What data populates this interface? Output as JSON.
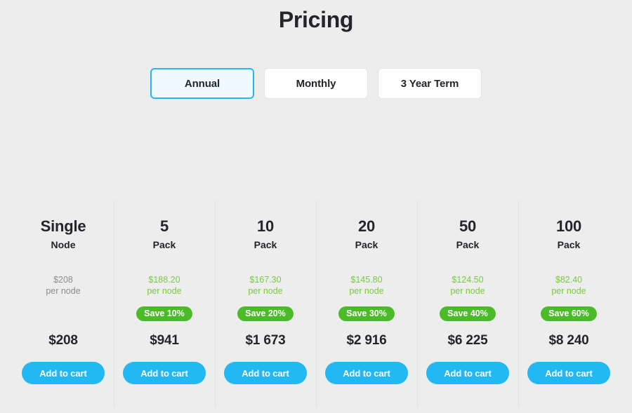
{
  "header": {
    "title": "Pricing"
  },
  "term_tabs": {
    "selected": "Annual",
    "items": [
      {
        "label": "Annual",
        "active": true
      },
      {
        "label": "Monthly",
        "active": false
      },
      {
        "label": "3 Year Term",
        "active": false
      }
    ]
  },
  "colors": {
    "page_background": "#ededed",
    "accent_blue": "#22b8f4",
    "tab_active_background": "#eff9ff",
    "tab_active_border": "#29b6f6",
    "badge_green": "#4cbb2a",
    "discount_text_green": "#7ac943",
    "muted_text": "#8c8c93",
    "divider": "#e1e1e1"
  },
  "plans": [
    {
      "quantity": "Single",
      "unit": "Node",
      "per_node_amount": "$208",
      "per_node_label": "per node",
      "discounted": false,
      "save_badge": null,
      "total": "$208",
      "cta_label": "Add to cart"
    },
    {
      "quantity": "5",
      "unit": "Pack",
      "per_node_amount": "$188.20",
      "per_node_label": "per node",
      "discounted": true,
      "save_badge": "Save 10%",
      "total": "$941",
      "cta_label": "Add to cart"
    },
    {
      "quantity": "10",
      "unit": "Pack",
      "per_node_amount": "$167.30",
      "per_node_label": "per node",
      "discounted": true,
      "save_badge": "Save 20%",
      "total": "$1 673",
      "cta_label": "Add to cart"
    },
    {
      "quantity": "20",
      "unit": "Pack",
      "per_node_amount": "$145.80",
      "per_node_label": "per node",
      "discounted": true,
      "save_badge": "Save 30%",
      "total": "$2 916",
      "cta_label": "Add to cart"
    },
    {
      "quantity": "50",
      "unit": "Pack",
      "per_node_amount": "$124.50",
      "per_node_label": "per node",
      "discounted": true,
      "save_badge": "Save 40%",
      "total": "$6 225",
      "cta_label": "Add to cart"
    },
    {
      "quantity": "100",
      "unit": "Pack",
      "per_node_amount": "$82.40",
      "per_node_label": "per node",
      "discounted": true,
      "save_badge": "Save 60%",
      "total": "$8 240",
      "cta_label": "Add to cart"
    }
  ]
}
